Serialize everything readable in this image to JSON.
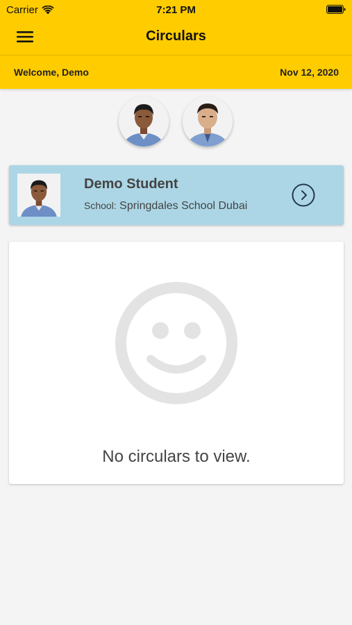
{
  "status_bar": {
    "carrier": "Carrier",
    "time": "7:21 PM"
  },
  "nav": {
    "title": "Circulars",
    "menu_icon": "hamburger-menu-icon"
  },
  "welcome": {
    "greeting": "Welcome, Demo",
    "date": "Nov 12, 2020"
  },
  "students": [
    {
      "avatar_icon": "student-photo-1"
    },
    {
      "avatar_icon": "student-photo-2"
    }
  ],
  "card": {
    "name": "Demo Student",
    "school_label": "School:",
    "school_name": "Springdales School Dubai",
    "chevron_icon": "chevron-right-circle-icon",
    "background": "#acd6e6"
  },
  "empty_state": {
    "icon": "smiley-face-icon",
    "message": "No circulars to view."
  },
  "colors": {
    "brand_yellow": "#ffcc00",
    "page_background": "#f4f4f4"
  }
}
